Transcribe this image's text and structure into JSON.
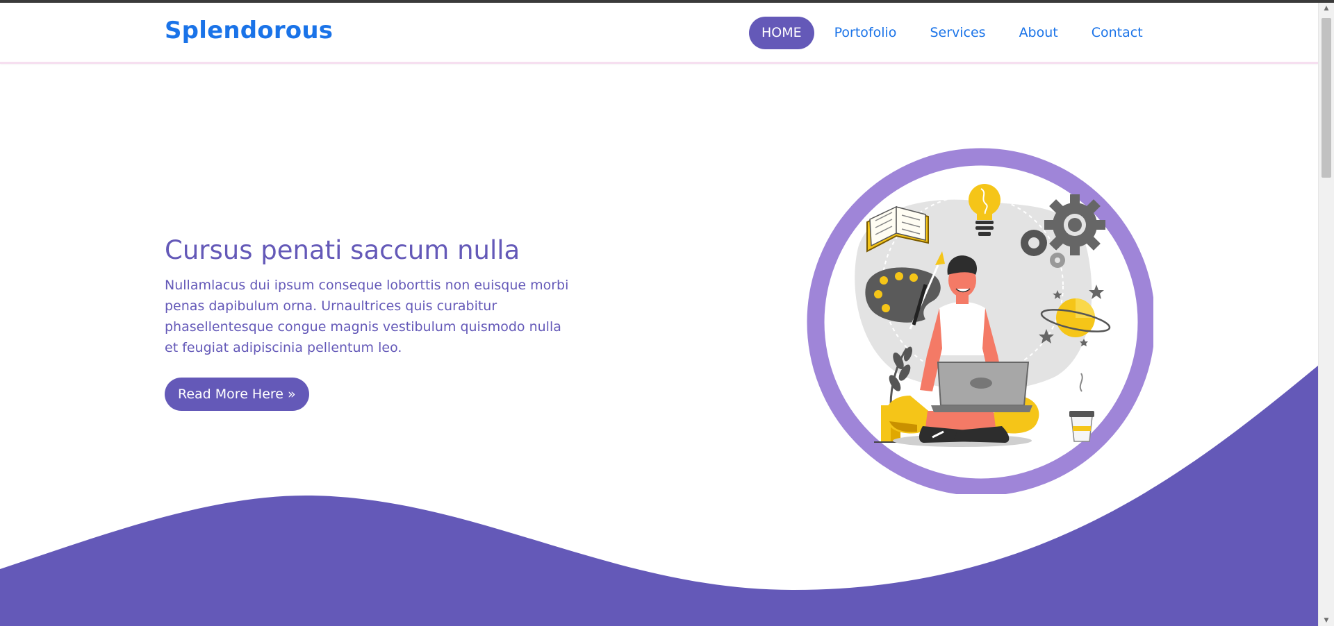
{
  "brand": {
    "name": "Splendorous"
  },
  "nav": {
    "items": [
      {
        "label": "HOME",
        "active": true
      },
      {
        "label": "Portofolio",
        "active": false
      },
      {
        "label": "Services",
        "active": false
      },
      {
        "label": "About",
        "active": false
      },
      {
        "label": "Contact",
        "active": false
      }
    ]
  },
  "hero": {
    "title": "Cursus penati saccum nulla",
    "text": "Nullamlacus dui ipsum conseque loborttis non euisque morbi penas dapibulum orna. Urnaultrices quis curabitur phasellentesque congue magnis vestibulum quismodo nulla et feugiat adipiscinia pellentum leo.",
    "button_label": "Read More Here »"
  },
  "illustration": {
    "icons": [
      "open-book-icon",
      "light-bulb-icon",
      "gear-icon",
      "paint-palette-icon",
      "planet-icon",
      "star-icon",
      "plant-icon",
      "coffee-cup-icon",
      "laptop-icon"
    ]
  },
  "colors": {
    "accent": "#6459b8",
    "brand": "#1a73e8",
    "ring": "#9f85d8",
    "nav_border": "#f6dff0"
  }
}
